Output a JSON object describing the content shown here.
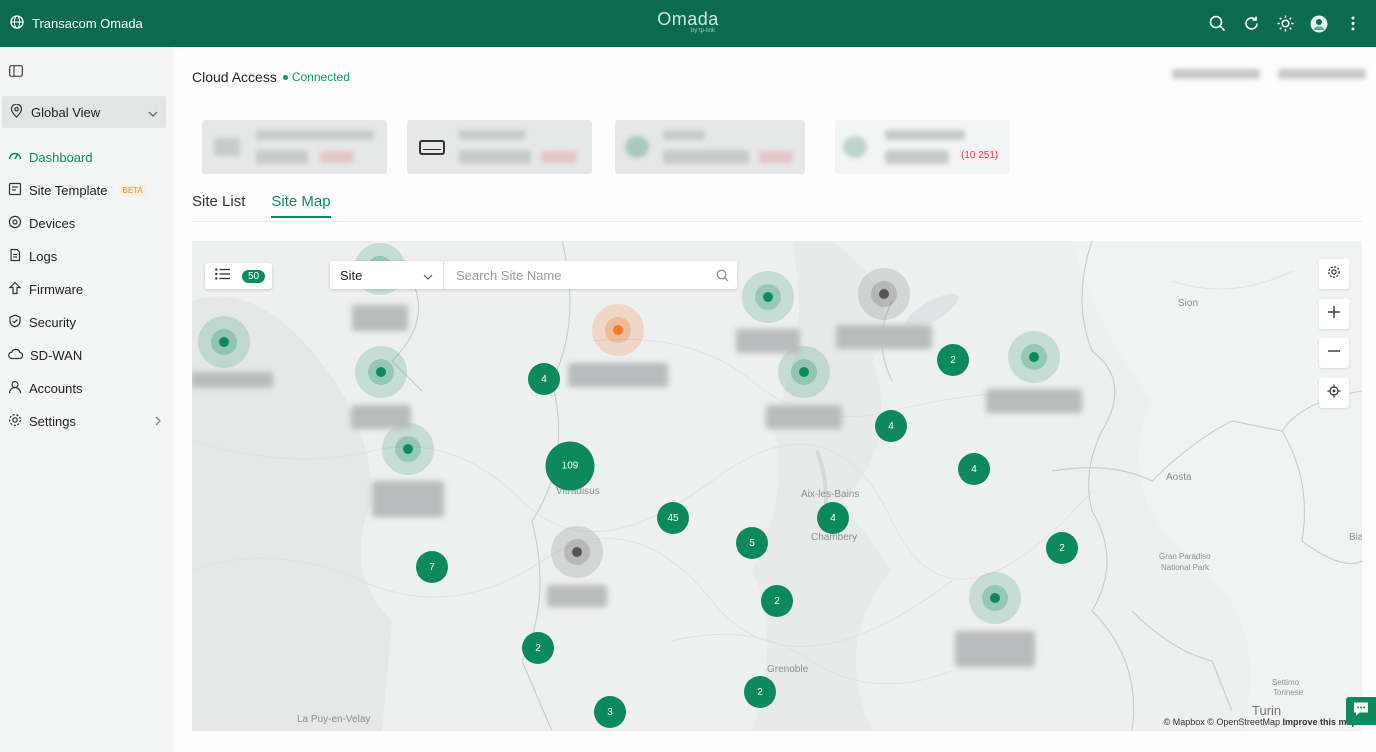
{
  "topbar": {
    "org_name": "Transacom Omada",
    "brand": "Omada",
    "brand_sub": "by tp-link",
    "icons": [
      "search-icon",
      "refresh-icon",
      "theme-icon",
      "avatar",
      "more-icon"
    ]
  },
  "sidebar": {
    "global_view": "Global View",
    "items": [
      {
        "label": "Dashboard",
        "icon": "dashboard-icon",
        "active": true
      },
      {
        "label": "Site Template",
        "icon": "site-template-icon",
        "badge": "BETA"
      },
      {
        "label": "Devices",
        "icon": "devices-icon"
      },
      {
        "label": "Logs",
        "icon": "logs-icon"
      },
      {
        "label": "Firmware",
        "icon": "firmware-icon"
      },
      {
        "label": "Security",
        "icon": "shield-icon"
      },
      {
        "label": "SD-WAN",
        "icon": "cloud-icon"
      },
      {
        "label": "Accounts",
        "icon": "user-icon"
      },
      {
        "label": "Settings",
        "icon": "gear-icon",
        "has_submenu": true
      }
    ]
  },
  "header": {
    "title": "Cloud Access",
    "status": "Connected"
  },
  "stats": {
    "alert_badge": "(10 251)"
  },
  "tabs": [
    {
      "label": "Site List",
      "active": false
    },
    {
      "label": "Site Map",
      "active": true
    }
  ],
  "map": {
    "list_count": "50",
    "filter_select": "Site",
    "search_placeholder": "Search Site Name",
    "labels": [
      "Sion",
      "Aosta",
      "Vitradisus",
      "Aix-les-Bains",
      "Chambery",
      "Gran Paradiso",
      "National Park",
      "Bia",
      "Grenoble",
      "Turin",
      "Settimo",
      "Torinese",
      "La Puy-en-Velay"
    ],
    "clusters": [
      "4",
      "109",
      "45",
      "7",
      "5",
      "2",
      "2",
      "3",
      "2",
      "4",
      "4",
      "4",
      "2",
      "2",
      "2"
    ],
    "attribution": {
      "mapbox": "© Mapbox",
      "osm": "© OpenStreetMap",
      "improve": "Improve this map"
    }
  },
  "colors": {
    "brand": "#0b6b4f",
    "accent": "#0b8a5f",
    "cluster": "#0d8a5d",
    "warning_pin": "#f07a2a",
    "offline_pin": "#555555",
    "alert_text": "#d8414e"
  }
}
